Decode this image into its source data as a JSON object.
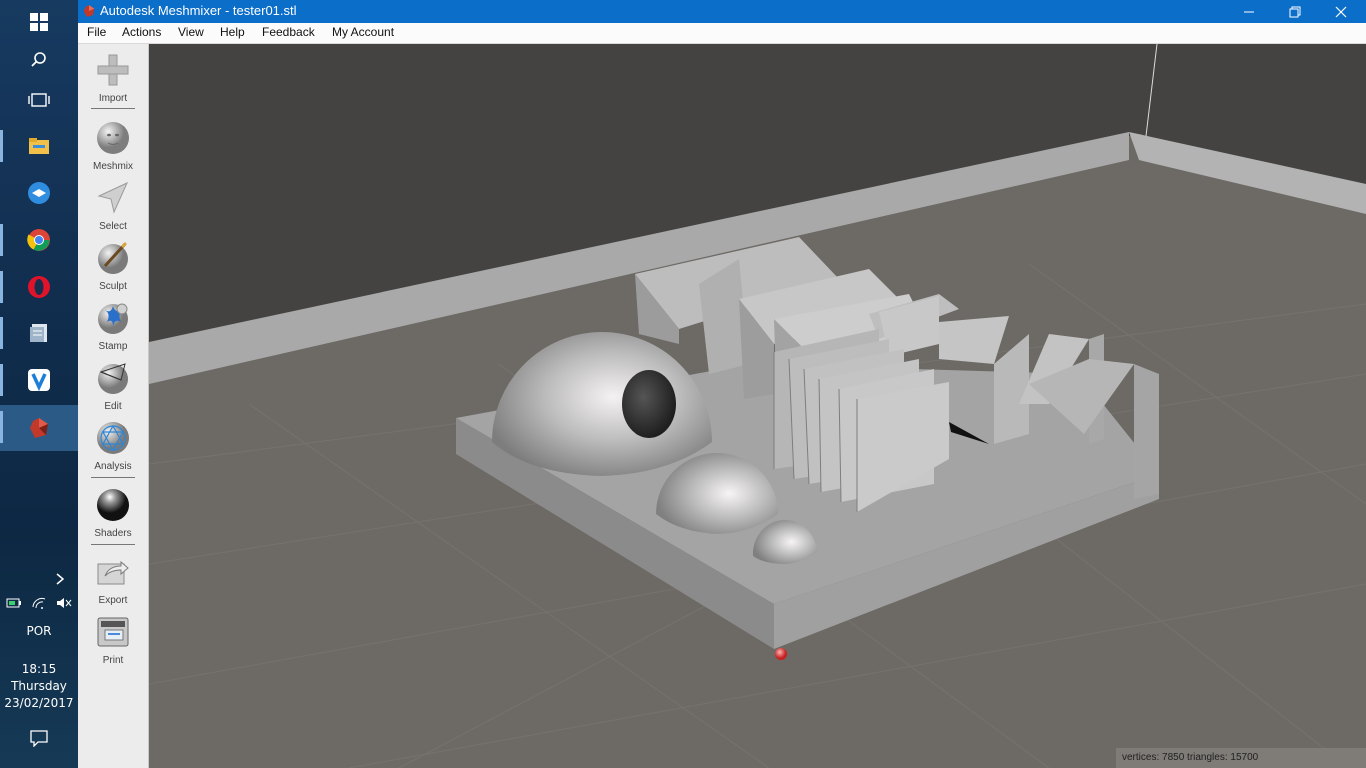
{
  "window": {
    "title": "Autodesk Meshmixer - tester01.stl"
  },
  "menu": [
    "File",
    "Actions",
    "View",
    "Help",
    "Feedback",
    "My Account"
  ],
  "tools": [
    {
      "label": "Import",
      "icon": "import-icon"
    },
    {
      "label": "Meshmix",
      "icon": "meshmix-icon"
    },
    {
      "label": "Select",
      "icon": "select-icon"
    },
    {
      "label": "Sculpt",
      "icon": "sculpt-icon"
    },
    {
      "label": "Stamp",
      "icon": "stamp-icon"
    },
    {
      "label": "Edit",
      "icon": "edit-icon"
    },
    {
      "label": "Analysis",
      "icon": "analysis-icon"
    },
    {
      "label": "Shaders",
      "icon": "shaders-icon"
    },
    {
      "label": "Export",
      "icon": "export-icon"
    },
    {
      "label": "Print",
      "icon": "print-icon"
    }
  ],
  "status": {
    "text": "vertices: 7850 triangles: 15700"
  },
  "tray": {
    "language": "POR",
    "time": "18:15",
    "day": "Thursday",
    "date": "23/02/2017"
  },
  "colors": {
    "titlebar": "#0b6ec9",
    "floor": "#6d6a66",
    "wall": "#464442",
    "model": "#a8a8a8"
  }
}
